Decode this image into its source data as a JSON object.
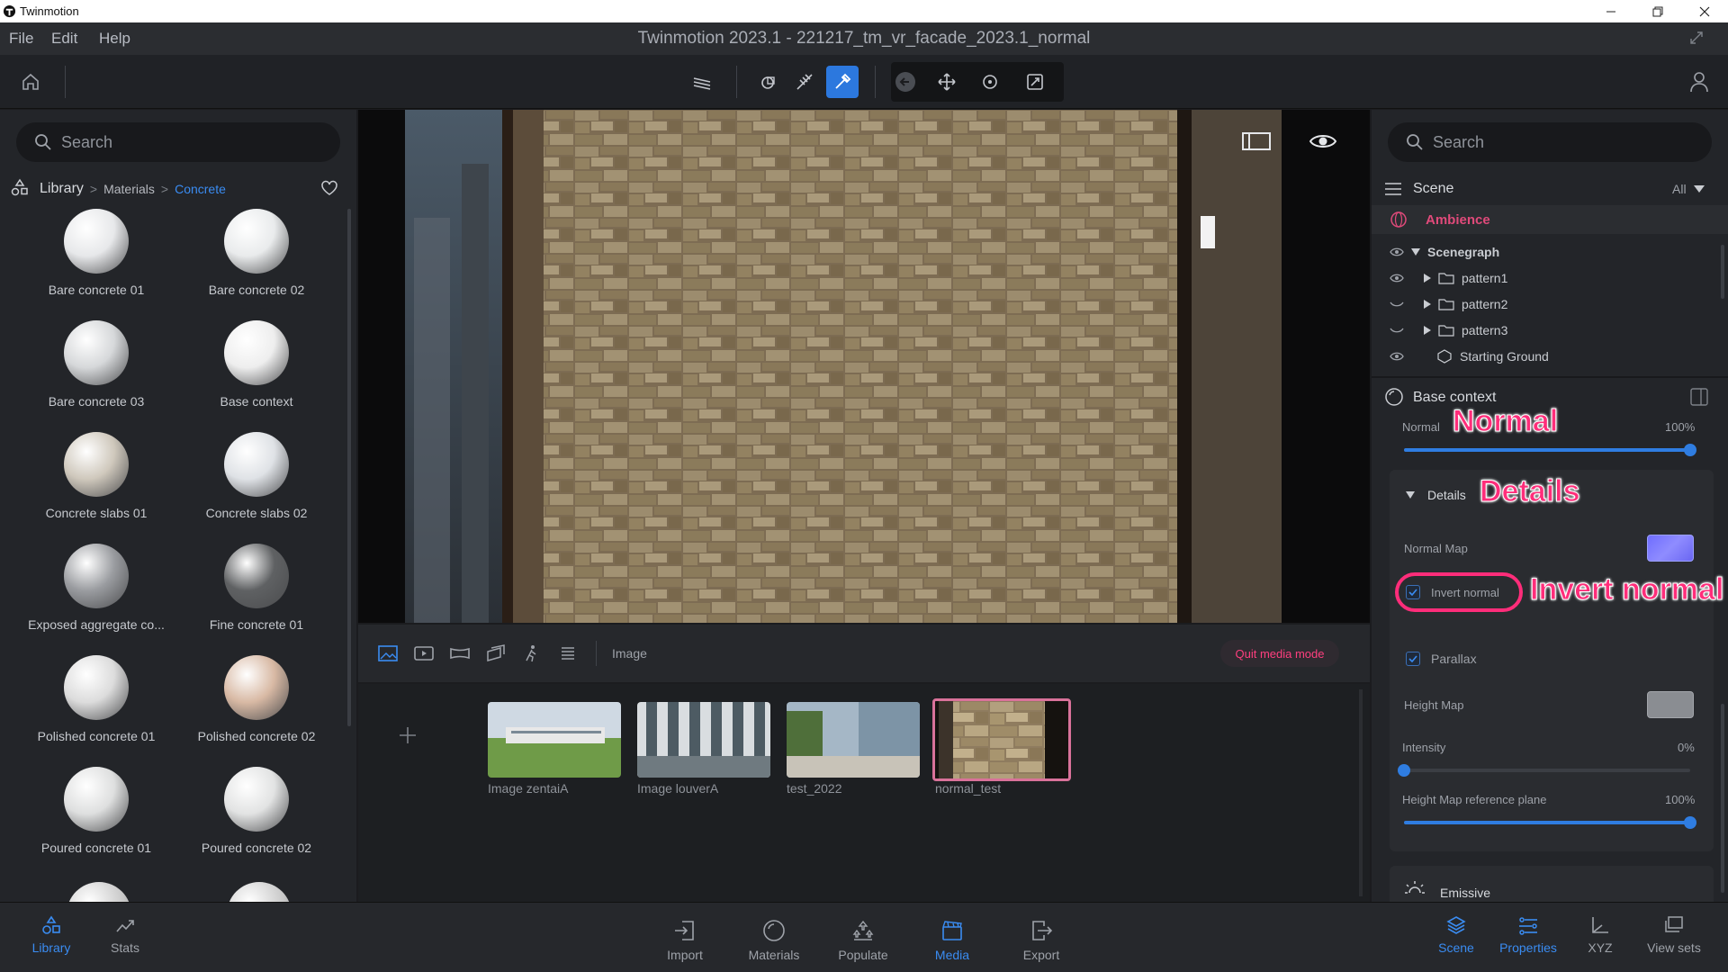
{
  "os_bar": {
    "app_name": "Twinmotion"
  },
  "menu": {
    "items": [
      "File",
      "Edit",
      "Help"
    ]
  },
  "document_title": "Twinmotion 2023.1 - 221217_tm_vr_facade_2023.1_normal",
  "library": {
    "search_placeholder": "Search",
    "breadcrumb": {
      "root": "Library",
      "sep1": ">",
      "level1": "Materials",
      "sep2": ">",
      "current": "Concrete"
    },
    "materials": [
      {
        "label": "Bare concrete 01",
        "color": "#e7e8ea"
      },
      {
        "label": "Bare concrete 02",
        "color": "#e9ebec"
      },
      {
        "label": "Bare concrete 03",
        "color": "#d6d8da"
      },
      {
        "label": "Base context",
        "color": "#eeeeee"
      },
      {
        "label": "Concrete slabs 01",
        "color": "#cfc8bc"
      },
      {
        "label": "Concrete slabs 02",
        "color": "#dfe2e6"
      },
      {
        "label": "Exposed aggregate co...",
        "color": "#9a9ca0"
      },
      {
        "label": "Fine concrete 01",
        "color": "#5f6163"
      },
      {
        "label": "Polished concrete 01",
        "color": "#dcdcdc"
      },
      {
        "label": "Polished concrete 02",
        "color": "#d8b9a4"
      },
      {
        "label": "Poured concrete 01",
        "color": "#dedfdf"
      },
      {
        "label": "Poured concrete 02",
        "color": "#e2e3e3"
      }
    ]
  },
  "media": {
    "type_label": "Image",
    "quit_label": "Quit media mode",
    "thumbnails": [
      {
        "label": "Image zentaiA"
      },
      {
        "label": "Image louverA"
      },
      {
        "label": "test_2022"
      },
      {
        "label": "normal_test"
      }
    ]
  },
  "scene": {
    "search_placeholder": "Search",
    "title": "Scene",
    "filter": "All",
    "ambience": "Ambience",
    "scenegraph": "Scenegraph",
    "items": [
      "pattern1",
      "pattern2",
      "pattern3",
      "Starting Ground"
    ]
  },
  "properties": {
    "material_name": "Base context",
    "normal_label": "Normal",
    "normal_value": "100%",
    "normal_level": 1.0,
    "details_label": "Details",
    "normal_map_label": "Normal Map",
    "invert_normal_label": "Invert normal",
    "invert_normal_checked": true,
    "parallax_label": "Parallax",
    "parallax_checked": true,
    "height_map_label": "Height Map",
    "intensity_label": "Intensity",
    "intensity_value": "0%",
    "intensity_level": 0.0,
    "hm_ref_label": "Height Map reference plane",
    "hm_ref_value": "100%",
    "hm_ref_level": 1.0,
    "emissive_label": "Emissive"
  },
  "annotations": {
    "normal": "Normal",
    "details": "Details",
    "invert_normal": "Invert normal"
  },
  "bottom_nav": {
    "left": [
      {
        "label": "Library",
        "active": true
      },
      {
        "label": "Stats",
        "active": false
      }
    ],
    "center": [
      {
        "label": "Import",
        "active": false
      },
      {
        "label": "Materials",
        "active": false
      },
      {
        "label": "Populate",
        "active": false
      },
      {
        "label": "Media",
        "active": true
      },
      {
        "label": "Export",
        "active": false
      }
    ],
    "right": [
      {
        "label": "Scene",
        "active": true
      },
      {
        "label": "Properties",
        "active": true
      },
      {
        "label": "XYZ",
        "active": false
      },
      {
        "label": "View sets",
        "active": false
      }
    ]
  },
  "colors": {
    "accent": "#2f7de1",
    "annotation": "#ff2d7a",
    "ambience": "#e04a7a",
    "quit": "#ff3f7f"
  }
}
